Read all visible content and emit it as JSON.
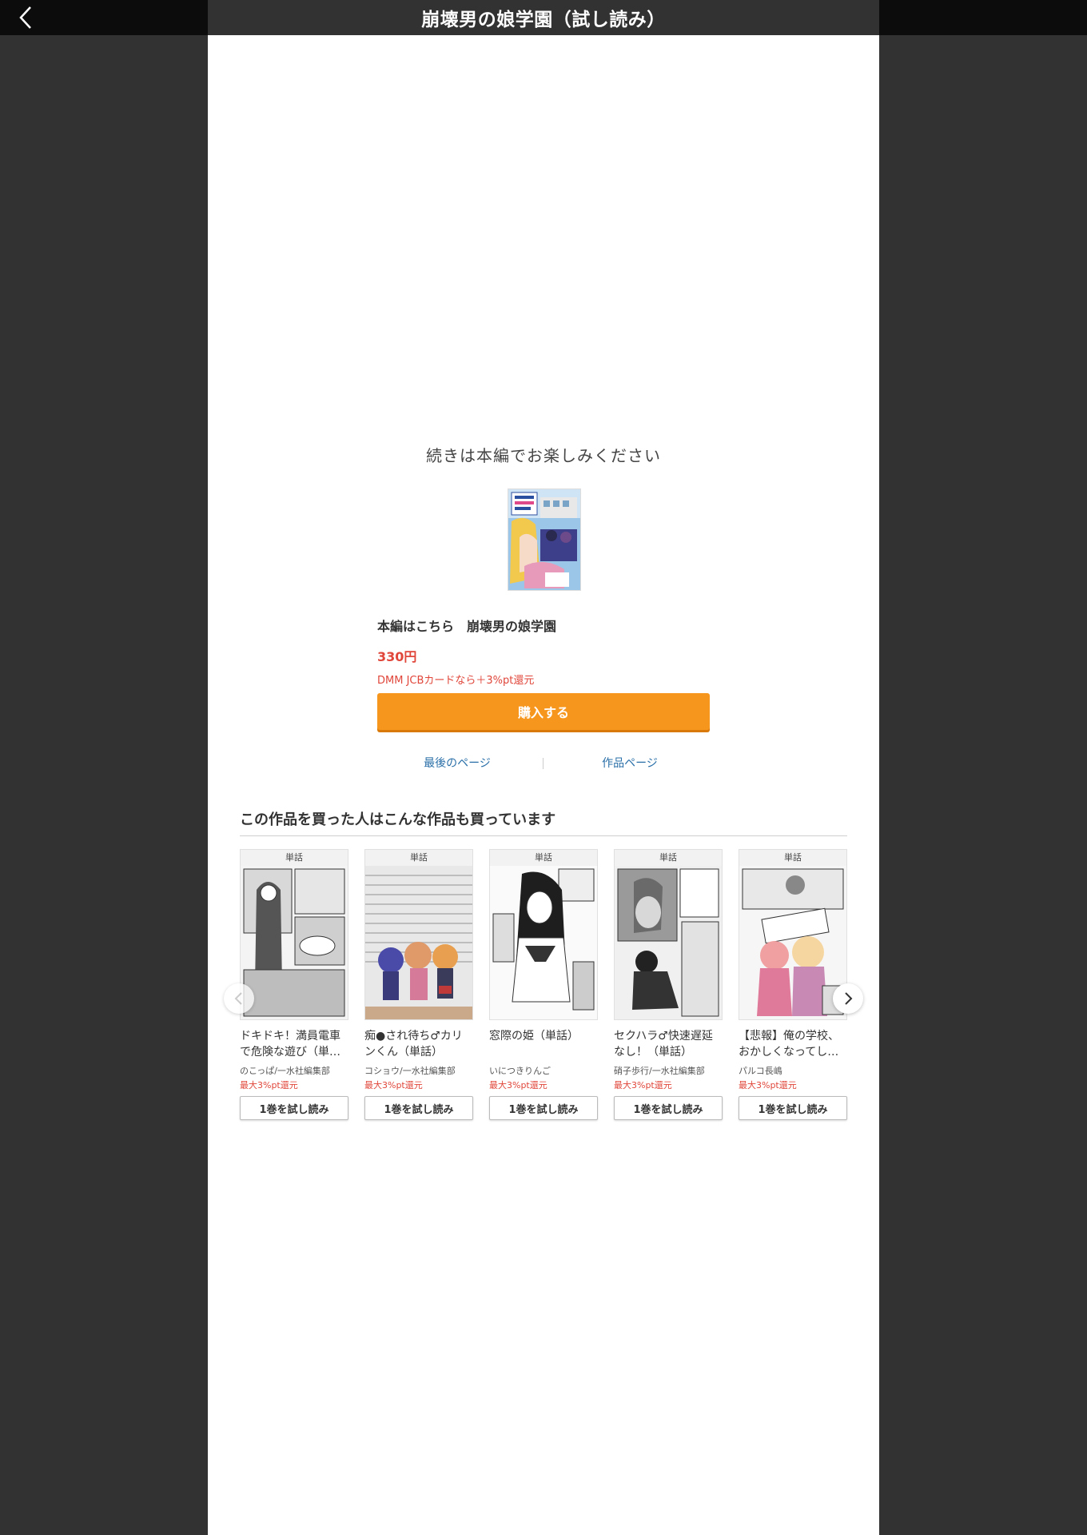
{
  "header": {
    "title": "崩壊男の娘学園（試し読み）"
  },
  "main": {
    "continue_message": "続きは本編でお楽しみください",
    "product_name": "本編はこちら　崩壊男の娘学園",
    "price": "330円",
    "promo": "DMM JCBカードなら＋3%pt還元",
    "buy_label": "購入する",
    "link_last_page": "最後のページ",
    "link_work_page": "作品ページ"
  },
  "recommend": {
    "heading": "この作品を買った人はこんな作品も買っています",
    "items": [
      {
        "tag": "単話",
        "title": "ドキドキ！満員電車で危険な遊び（単…",
        "author": "のこっぱ/一水社編集部",
        "points": "最大3%pt還元",
        "button": "1巻を試し読み"
      },
      {
        "tag": "単話",
        "title": "痴●され待ち♂カリンくん（単話）",
        "author": "コショウ/一水社編集部",
        "points": "最大3%pt還元",
        "button": "1巻を試し読み"
      },
      {
        "tag": "単話",
        "title": "窓際の姫（単話）",
        "author": "いにつきりんご",
        "points": "最大3%pt還元",
        "button": "1巻を試し読み"
      },
      {
        "tag": "単話",
        "title": "セクハラ♂快速遅延なし！（単話）",
        "author": "硝子歩行/一水社編集部",
        "points": "最大3%pt還元",
        "button": "1巻を試し読み"
      },
      {
        "tag": "単話",
        "title": "【悲報】俺の学校、おかしくなってし…",
        "author": "パルコ長嶋",
        "points": "最大3%pt還元",
        "button": "1巻を試し読み"
      }
    ]
  },
  "icons": {
    "back": "chevron-left-icon",
    "carousel_prev": "chevron-left-icon",
    "carousel_next": "chevron-right-icon"
  },
  "colors": {
    "buy_button": "#f7961c",
    "price": "#e0463a",
    "link": "#2a6fa8",
    "page_background": "#323232"
  }
}
